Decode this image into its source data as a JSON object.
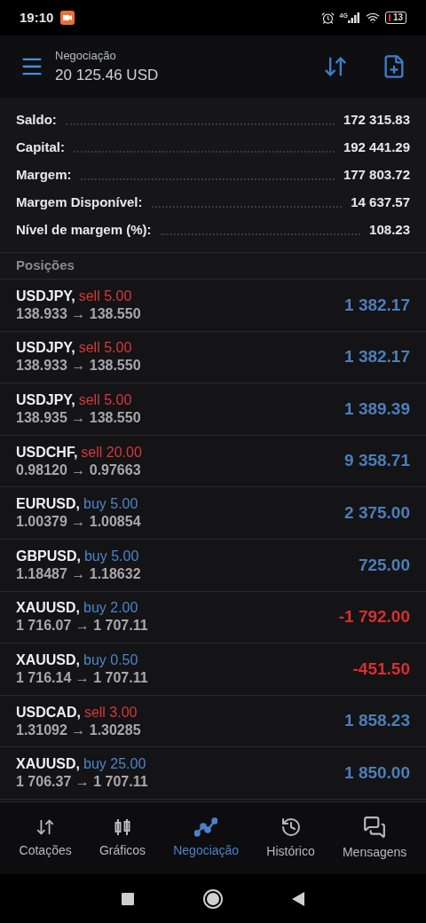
{
  "status_bar": {
    "time": "19:10",
    "network": "4G",
    "battery": "13"
  },
  "header": {
    "title": "Negociação",
    "balance": "20 125.46 USD"
  },
  "summary": [
    {
      "label": "Saldo:",
      "value": "172 315.83"
    },
    {
      "label": "Capital:",
      "value": "192 441.29"
    },
    {
      "label": "Margem:",
      "value": "177 803.72"
    },
    {
      "label": "Margem Disponível:",
      "value": "14 637.57"
    },
    {
      "label": "Nível de margem (%):",
      "value": "108.23"
    }
  ],
  "positions_title": "Posições",
  "positions": [
    {
      "symbol": "USDJPY,",
      "side": "sell",
      "volume": "5.00",
      "prices": "138.933 → 138.550",
      "profit": "1 382.17",
      "loss": false
    },
    {
      "symbol": "USDJPY,",
      "side": "sell",
      "volume": "5.00",
      "prices": "138.933 → 138.550",
      "profit": "1 382.17",
      "loss": false
    },
    {
      "symbol": "USDJPY,",
      "side": "sell",
      "volume": "5.00",
      "prices": "138.935 → 138.550",
      "profit": "1 389.39",
      "loss": false
    },
    {
      "symbol": "USDCHF,",
      "side": "sell",
      "volume": "20.00",
      "prices": "0.98120 → 0.97663",
      "profit": "9 358.71",
      "loss": false
    },
    {
      "symbol": "EURUSD,",
      "side": "buy",
      "volume": "5.00",
      "prices": "1.00379 → 1.00854",
      "profit": "2 375.00",
      "loss": false
    },
    {
      "symbol": "GBPUSD,",
      "side": "buy",
      "volume": "5.00",
      "prices": "1.18487 → 1.18632",
      "profit": "725.00",
      "loss": false
    },
    {
      "symbol": "XAUUSD,",
      "side": "buy",
      "volume": "2.00",
      "prices": "1 716.07 → 1 707.11",
      "profit": "-1 792.00",
      "loss": true
    },
    {
      "symbol": "XAUUSD,",
      "side": "buy",
      "volume": "0.50",
      "prices": "1 716.14 → 1 707.11",
      "profit": "-451.50",
      "loss": true
    },
    {
      "symbol": "USDCAD,",
      "side": "sell",
      "volume": "3.00",
      "prices": "1.31092 → 1.30285",
      "profit": "1 858.23",
      "loss": false
    },
    {
      "symbol": "XAUUSD,",
      "side": "buy",
      "volume": "25.00",
      "prices": "1 706.37 → 1 707.11",
      "profit": "1 850.00",
      "loss": false
    }
  ],
  "tabs": [
    {
      "label": "Cotações",
      "kind": "quotes",
      "selected": false
    },
    {
      "label": "Gráficos",
      "kind": "charts",
      "selected": false
    },
    {
      "label": "Negociação",
      "kind": "trade",
      "selected": true
    },
    {
      "label": "Histórico",
      "kind": "history",
      "selected": false
    },
    {
      "label": "Mensagens",
      "kind": "messages",
      "selected": false
    }
  ]
}
